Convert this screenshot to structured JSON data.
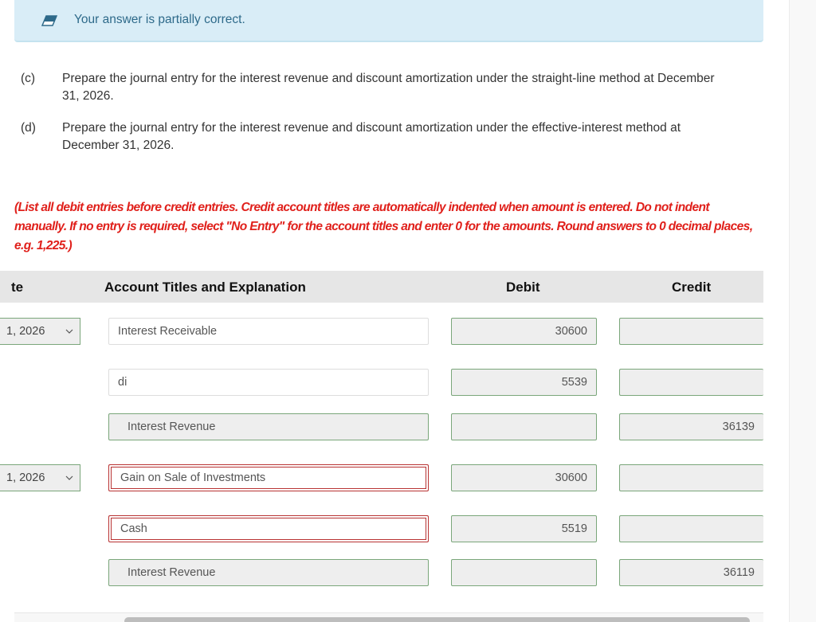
{
  "feedback": {
    "icon": "eraser-icon",
    "message": "Your answer is partially correct.",
    "background_color": "#d9edf7"
  },
  "questions": [
    {
      "tag": "(c)",
      "text": "Prepare the journal entry for the interest revenue and discount amortization under the straight-line method at December 31, 2026."
    },
    {
      "tag": "(d)",
      "text": "Prepare the journal entry for the interest revenue and discount amortization under the effective-interest method at December 31, 2026."
    }
  ],
  "instructions": "(List all debit entries before credit entries. Credit account titles are automatically indented when amount is entered. Do not indent manually. If no entry is required, select \"No Entry\" for the account titles and enter 0 for the amounts. Round answers to 0 decimal places, e.g. 1,225.)",
  "table": {
    "headers": {
      "date": "te",
      "account": "Account Titles and Explanation",
      "debit": "Debit",
      "credit": "Credit"
    },
    "entries": [
      {
        "date": "1, 2026",
        "rows": [
          {
            "account": "Interest Receivable",
            "debit": "30600",
            "credit": ""
          },
          {
            "account": "di",
            "debit": "5539",
            "credit": ""
          },
          {
            "account": "Interest Revenue",
            "debit": "",
            "credit": "36139"
          }
        ]
      },
      {
        "date": "1, 2026",
        "rows": [
          {
            "account": "Gain on Sale of Investments",
            "debit": "30600",
            "credit": ""
          },
          {
            "account": "Cash",
            "debit": "5519",
            "credit": ""
          },
          {
            "account": "Interest Revenue",
            "debit": "",
            "credit": "36119"
          }
        ]
      }
    ]
  },
  "colors": {
    "correct_border": "#7aa67a",
    "incorrect_border": "#b83232",
    "instruction_text": "#e0201b"
  }
}
